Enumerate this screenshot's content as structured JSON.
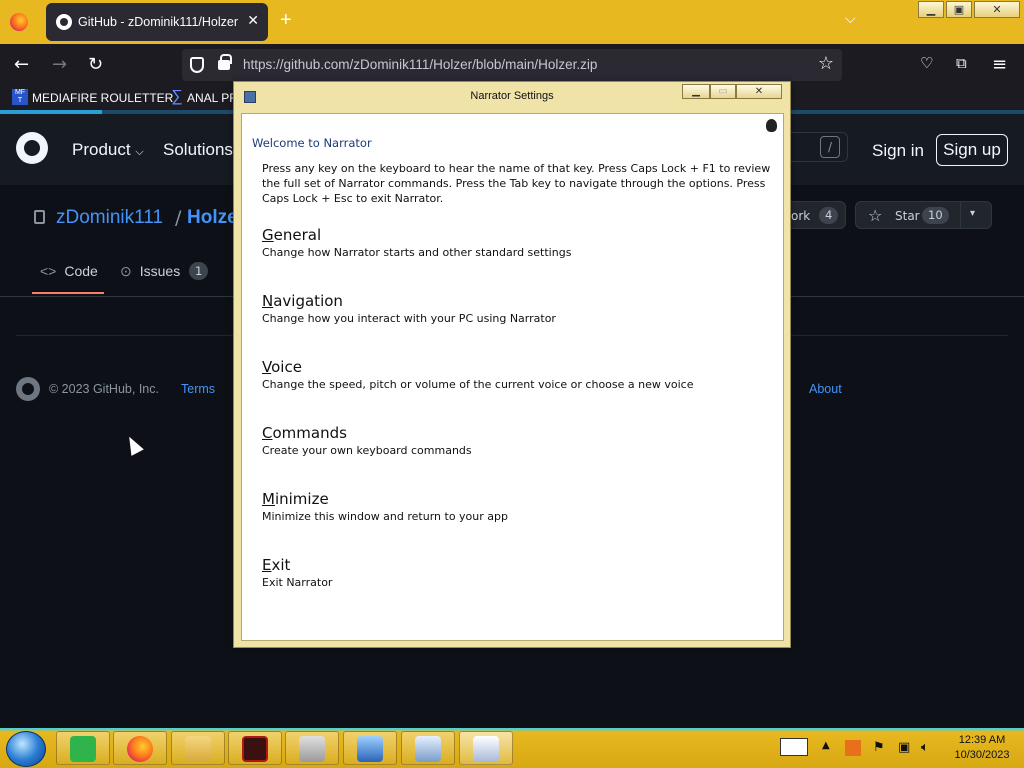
{
  "browser": {
    "tab_title": "GitHub - zDominik111/Holzer",
    "tab_close": "✕",
    "new_tab": "+",
    "tab_list": "⌵",
    "url": "https://github.com/zDominik111/Holzer/blob/main/Holzer.zip",
    "bookmarks": [
      {
        "label": "MEDIAFIRE ROULETTER",
        "icon_text": "MF T"
      },
      {
        "label": "ANAL PF"
      }
    ],
    "window_controls": {
      "minimize": "▁",
      "maximize": "▣",
      "close": "✕"
    }
  },
  "github": {
    "nav": {
      "product": "Product",
      "solutions": "Solutions",
      "sign_in": "Sign in",
      "sign_up": "Sign up",
      "search_key": "/"
    },
    "repo": {
      "owner": "zDominik111",
      "slash": "/",
      "name": "Holze",
      "fork_label": "ork",
      "fork_count": "4",
      "star_label": "Star",
      "star_count": "10"
    },
    "tabs": [
      {
        "label": "Code",
        "icon": "<>"
      },
      {
        "label": "Issues",
        "icon": "⊙",
        "count": "1"
      }
    ],
    "footer": {
      "copyright": "© 2023 GitHub, Inc.",
      "terms": "Terms",
      "about": "About"
    }
  },
  "narrator": {
    "title": "Narrator Settings",
    "controls": {
      "minimize": "▁",
      "maximize": "▭",
      "close": "✕"
    },
    "welcome": "Welcome to Narrator",
    "intro": "Press any key on the keyboard to hear the name of that key.  Press Caps Lock + F1 to review the full set of Narrator commands.  Press the Tab key to navigate through the options.  Press Caps Lock + Esc to exit Narrator.",
    "options": [
      {
        "accel": "G",
        "rest": "eneral",
        "desc": "Change how Narrator starts and other standard settings"
      },
      {
        "accel": "N",
        "rest": "avigation",
        "desc": "Change how you interact with your PC using Narrator"
      },
      {
        "accel": "V",
        "rest": "oice",
        "desc": "Change the speed, pitch or volume of the current voice or choose a new voice"
      },
      {
        "accel": "C",
        "rest": "ommands",
        "desc": "Create your own keyboard commands"
      },
      {
        "accel": "M",
        "rest": "inimize",
        "desc": "Minimize this window and return to your app"
      },
      {
        "accel": "E",
        "rest": "xit",
        "desc": "Exit Narrator"
      }
    ]
  },
  "taskbar": {
    "clock_time": "12:39 AM",
    "clock_date": "10/30/2023",
    "items": [
      "text-editor-icon",
      "firefox-icon",
      "file-explorer-icon",
      "game-icon",
      "archive-icon",
      "network-icon",
      "calculator-icon",
      "on-screen-keyboard-icon"
    ]
  },
  "colors": {
    "taskbar": "#e8b820",
    "github_bg": "#0d1117",
    "link": "#4493f8",
    "narrator_frame": "#efe3a8"
  }
}
